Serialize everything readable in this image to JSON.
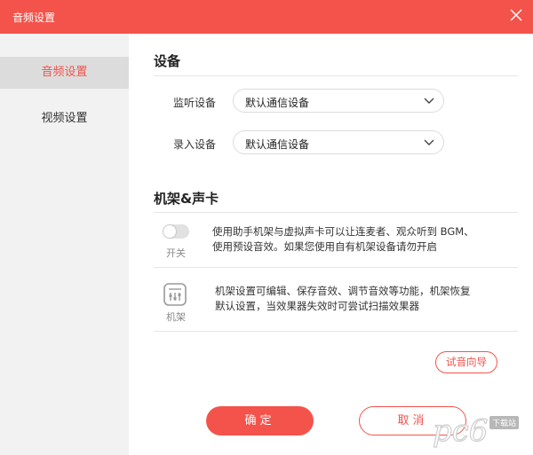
{
  "window": {
    "title": "音频设置"
  },
  "sidebar": {
    "items": [
      {
        "label": "音频设置",
        "active": true
      },
      {
        "label": "视频设置",
        "active": false
      }
    ]
  },
  "devices": {
    "title": "设备",
    "monitor": {
      "label": "监听设备",
      "value": "默认通信设备"
    },
    "input": {
      "label": "录入设备",
      "value": "默认通信设备"
    }
  },
  "rack": {
    "title": "机架&声卡",
    "switch": {
      "caption": "开关",
      "line1": "使用助手机架与虚拟声卡可以让连麦者、观众听到 BGM、",
      "line2": "使用预设音效。如果您使用自有机架设备请勿开启",
      "on": false
    },
    "config": {
      "caption": "机架",
      "line1": "机架设置可编辑、保存音效、调节音效等功能，机架恢复",
      "line2": "默认设置，当效果器失效时可尝试扫描效果器"
    },
    "wizard_label": "试音向导"
  },
  "footer": {
    "ok_label": "确定",
    "cancel_label": "取消"
  },
  "watermark": {
    "brand": "pc6",
    "sub": "下载站"
  },
  "colors": {
    "accent": "#f4534b",
    "sidebar_bg": "#f2f2f2",
    "sidebar_active": "#dcdcdc"
  },
  "icons": [
    "close-icon",
    "chevron-down-icon",
    "rack-icon"
  ]
}
